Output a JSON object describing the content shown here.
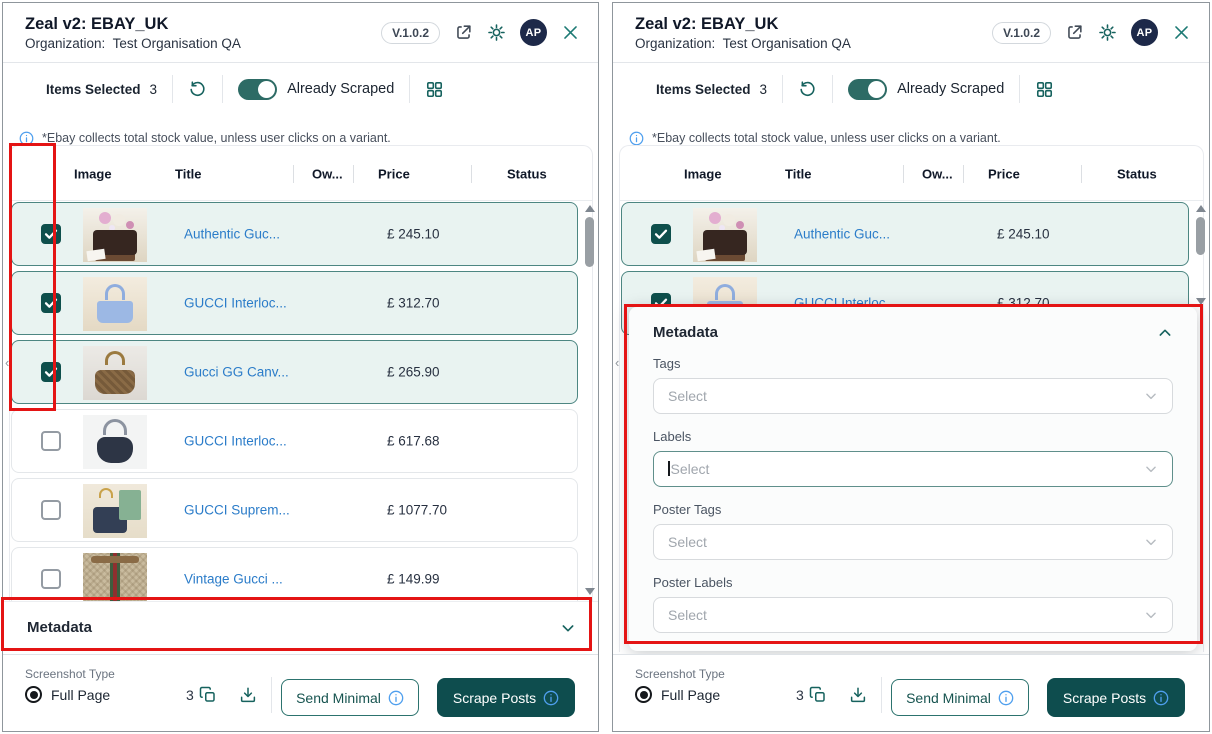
{
  "header": {
    "title": "Zeal v2: EBAY_UK",
    "organization_label": "Organization:",
    "organization_name": "Test Organisation QA",
    "version": "V.1.0.2",
    "avatar_initials": "AP"
  },
  "toolbar": {
    "items_selected_label": "Items Selected",
    "items_selected_count": "3",
    "already_scraped_label": "Already Scraped",
    "toggle_on": true
  },
  "notice_text": "*Ebay collects total stock value, unless user clicks on a variant.",
  "table": {
    "columns": {
      "image": "Image",
      "title": "Title",
      "owner": "Ow...",
      "price": "Price",
      "status": "Status"
    }
  },
  "items": [
    {
      "title": "Authentic Guc...",
      "price": "£ 245.10",
      "checked": true,
      "thumb": "t1"
    },
    {
      "title": "GUCCI Interloc...",
      "price": "£ 312.70",
      "checked": true,
      "thumb": "t2"
    },
    {
      "title": "Gucci GG Canv...",
      "price": "£ 265.90",
      "checked": true,
      "thumb": "t3"
    },
    {
      "title": "GUCCI Interloc...",
      "price": "£ 617.68",
      "checked": false,
      "thumb": "t4"
    },
    {
      "title": "GUCCI Suprem...",
      "price": "£ 1077.70",
      "checked": false,
      "thumb": "t5"
    },
    {
      "title": "Vintage Gucci ...",
      "price": "£ 149.99",
      "checked": false,
      "thumb": "t6"
    }
  ],
  "panels": {
    "left": {
      "visible_items": [
        0,
        1,
        2,
        3,
        4,
        5
      ],
      "metadata_expanded": false
    },
    "right": {
      "visible_items": [
        0,
        1
      ],
      "metadata_expanded": true
    }
  },
  "metadata": {
    "title": "Metadata",
    "fields": [
      {
        "label": "Tags",
        "placeholder": "Select",
        "focused": false
      },
      {
        "label": "Labels",
        "placeholder": "Select",
        "focused": true
      },
      {
        "label": "Poster Tags",
        "placeholder": "Select",
        "focused": false
      },
      {
        "label": "Poster Labels",
        "placeholder": "Select",
        "focused": false
      }
    ]
  },
  "footer": {
    "screenshot_type_label": "Screenshot Type",
    "full_page_label": "Full Page",
    "selected_count": "3",
    "send_minimal_label": "Send Minimal",
    "scrape_posts_label": "Scrape Posts"
  },
  "colors": {
    "accent_teal": "#16625e",
    "dark_button": "#0e4d4e",
    "selected_row_bg": "#e9f3f1",
    "selected_row_border": "#4d8682",
    "link_blue": "#2b7cc9",
    "info_blue": "#4f9fee",
    "annotation_red": "#e41414",
    "avatar_navy": "#1d2949"
  }
}
